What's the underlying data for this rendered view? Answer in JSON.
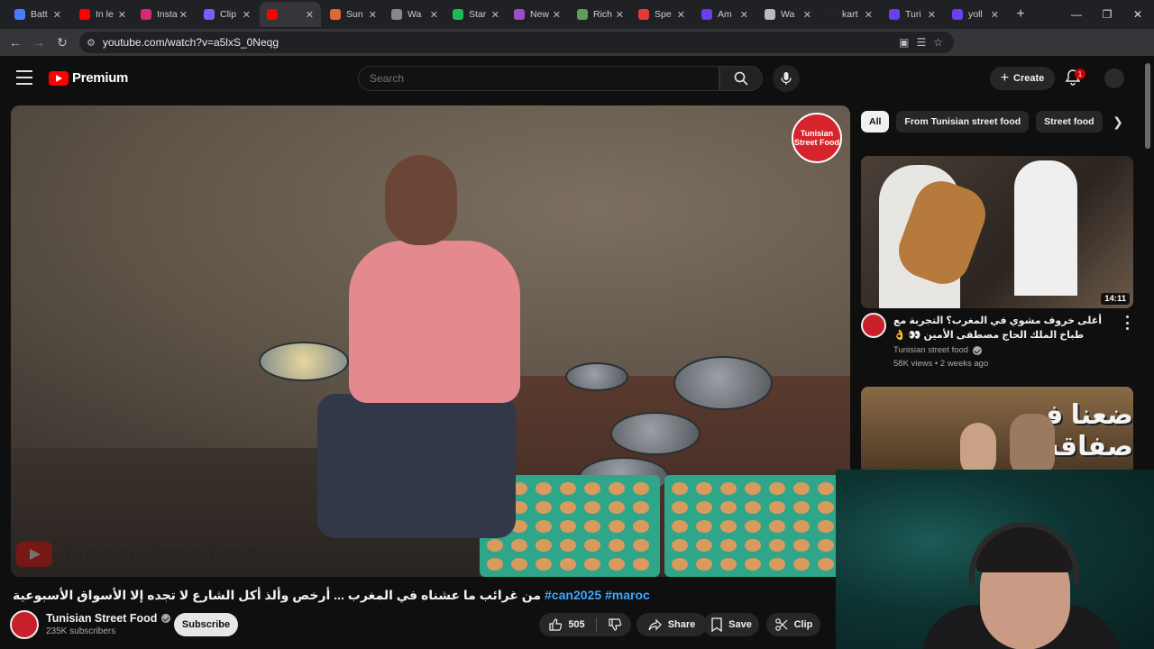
{
  "browser": {
    "tabs": [
      {
        "label": "Batt",
        "color": "#4a7cff"
      },
      {
        "label": "In le",
        "color": "#ff0000"
      },
      {
        "label": "Insta",
        "color": "#d62976"
      },
      {
        "label": "Clip",
        "color": "#7b5cff"
      },
      {
        "label": "",
        "color": "#ff0000",
        "active": true
      },
      {
        "label": "Sun",
        "color": "#e0673a"
      },
      {
        "label": "Wa",
        "color": "#888888"
      },
      {
        "label": "Star",
        "color": "#1db954"
      },
      {
        "label": "New",
        "color": "#9c4dcc"
      },
      {
        "label": "Rich",
        "color": "#5aa05a"
      },
      {
        "label": "Spe",
        "color": "#e53935"
      },
      {
        "label": "Am",
        "color": "#6a3df0"
      },
      {
        "label": "Wa",
        "color": "#bbbbbb"
      },
      {
        "label": "kart",
        "color": "#222222"
      },
      {
        "label": "Turi",
        "color": "#6a3df0"
      },
      {
        "label": "yoll",
        "color": "#6a3df0"
      }
    ],
    "url": "youtube.com/watch?v=a5lxS_0Neqg"
  },
  "youtube": {
    "logo_text": "Premium",
    "search_placeholder": "Search",
    "create_label": "Create",
    "notification_count": "1"
  },
  "video": {
    "brand_badge": "Tunisian Street Food",
    "watermark": "Tunisian Street Food",
    "title_arabic": "من غرائب ما عشناه في المغرب ... أرخص وألذ أكل الشارع لا تجده إلا الأسواق الأسبوعية",
    "title_hashtags": "#can2025 #maroc",
    "channel_name": "Tunisian Street Food",
    "subscribers": "235K subscribers",
    "subscribe_label": "Subscribe",
    "likes": "505",
    "share_label": "Share",
    "save_label": "Save",
    "clip_label": "Clip"
  },
  "sidebar": {
    "chips": [
      "All",
      "From Tunisian street food",
      "Street food"
    ],
    "recommendations": [
      {
        "title": "أغلى خروف مشوي في المغرب؟ التجربة مع طباخ الملك الحاج مصطفى الأمين 👀 👌",
        "channel": "Tunisian street food",
        "meta": "58K views • 2 weeks ago",
        "duration": "14:11"
      },
      {
        "thumb_text": "ضعنا في صفاقس!"
      }
    ]
  }
}
